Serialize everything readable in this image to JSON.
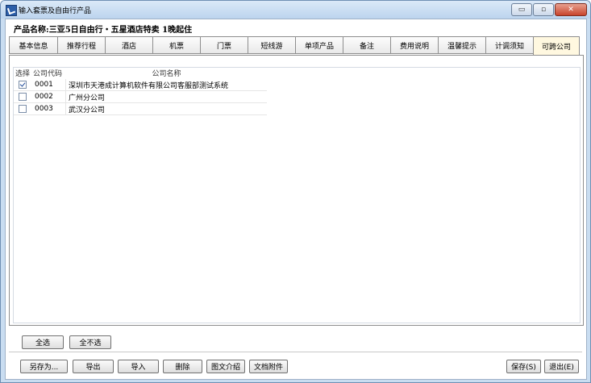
{
  "window": {
    "title": "输入套票及自由行产品",
    "controls": {
      "minimize": "▭",
      "restore": "▫",
      "close": "✕"
    }
  },
  "product_name": "产品名称:三亚5日自由行・五星酒店特卖 1晚起住",
  "tabs": [
    {
      "label": "基本信息"
    },
    {
      "label": "推荐行程"
    },
    {
      "label": "酒店"
    },
    {
      "label": "机票"
    },
    {
      "label": "门票"
    },
    {
      "label": "短线游"
    },
    {
      "label": "单项产品"
    },
    {
      "label": "备注"
    },
    {
      "label": "费用说明"
    },
    {
      "label": "温馨提示"
    },
    {
      "label": "计调须知"
    },
    {
      "label": "可跨公司"
    }
  ],
  "active_tab": "可跨公司",
  "grid": {
    "headers": {
      "select": "选择",
      "code": "公司代码",
      "name": "公司名称"
    },
    "rows": [
      {
        "checked": true,
        "code": "0001",
        "name": "深圳市天港成计算机软件有限公司客服部测试系统"
      },
      {
        "checked": false,
        "code": "0002",
        "name": "广州分公司"
      },
      {
        "checked": false,
        "code": "0003",
        "name": "武汉分公司"
      }
    ]
  },
  "selection_buttons": {
    "select_all": "全选",
    "select_none": "全不选"
  },
  "bottom_buttons": {
    "save_as": "另存为...",
    "export": "导出",
    "import": "导入",
    "delete": "删除",
    "intro": "图文介绍",
    "attachment": "文档附件",
    "save": "保存(S)",
    "exit": "退出(E)"
  }
}
